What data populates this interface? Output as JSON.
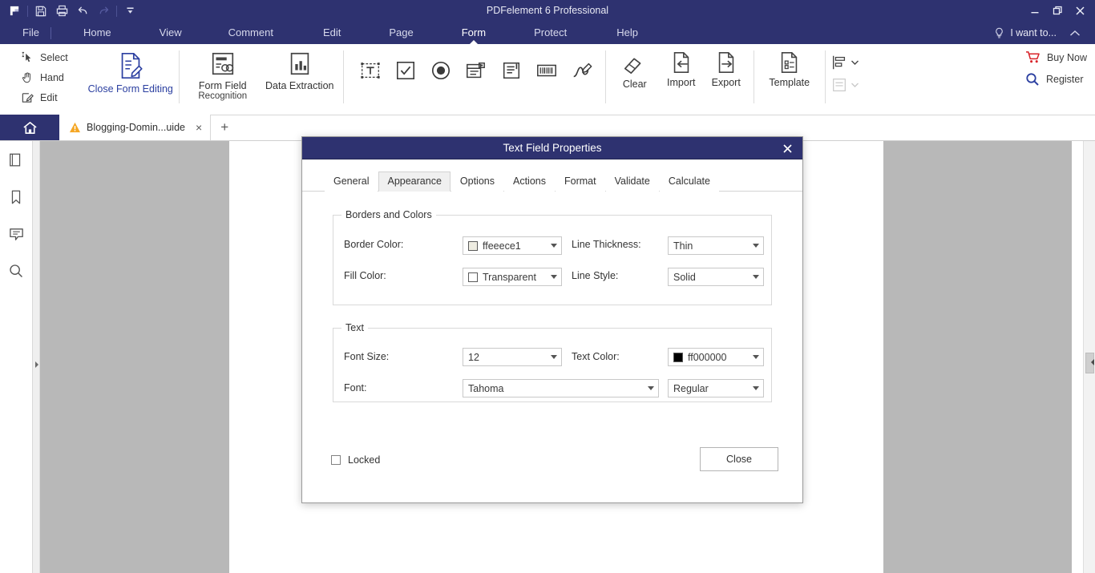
{
  "window": {
    "title": "PDFelement 6 Professional",
    "accent_color": "#2e3270",
    "quick_access": [
      {
        "name": "app-logo",
        "label": "PDFelement"
      },
      {
        "name": "save-icon",
        "label": "Save"
      },
      {
        "name": "print-icon",
        "label": "Print"
      },
      {
        "name": "undo-icon",
        "label": "Undo"
      },
      {
        "name": "redo-icon",
        "label": "Redo"
      },
      {
        "name": "customize-qat-icon",
        "label": "Customize Quick Access Toolbar"
      }
    ],
    "controls": {
      "minimize": "Minimize",
      "restore": "Restore",
      "close": "Close"
    }
  },
  "menubar": {
    "items": [
      {
        "label": "File",
        "active": false
      },
      {
        "label": "Home",
        "active": false
      },
      {
        "label": "View",
        "active": false
      },
      {
        "label": "Comment",
        "active": false
      },
      {
        "label": "Edit",
        "active": false
      },
      {
        "label": "Page",
        "active": false
      },
      {
        "label": "Form",
        "active": true
      },
      {
        "label": "Protect",
        "active": false
      },
      {
        "label": "Help",
        "active": false
      }
    ],
    "i_want_to": "I want to...",
    "collapse_icon": "chevron-up-icon"
  },
  "ribbon": {
    "tools_small": [
      {
        "label": "Select",
        "icon": "cursor-select-icon"
      },
      {
        "label": "Hand",
        "icon": "hand-icon"
      },
      {
        "label": "Edit",
        "icon": "edit-pencil-icon"
      }
    ],
    "close_form_editing": "Close Form Editing",
    "form_field_recognition": "Form Field\nRecognition",
    "form_field_recognition_line1": "Form Field",
    "form_field_recognition_line2": "Recognition",
    "data_extraction": "Data Extraction",
    "field_tools": [
      {
        "name": "text-field-tool",
        "label": "Text Field"
      },
      {
        "name": "check-box-tool",
        "label": "Check Box"
      },
      {
        "name": "radio-button-tool",
        "label": "Radio Button"
      },
      {
        "name": "combo-box-tool",
        "label": "Combo Box"
      },
      {
        "name": "list-box-tool",
        "label": "List Box"
      },
      {
        "name": "barcode-tool",
        "label": "Barcode"
      },
      {
        "name": "digital-signature-tool",
        "label": "Digital Signature"
      }
    ],
    "clear": "Clear",
    "import": "Import",
    "export": "Export",
    "template": "Template",
    "buy_now": "Buy Now",
    "register": "Register",
    "buy_now_color": "#d8232a"
  },
  "tabstrip": {
    "home_tab": "Home",
    "document_tab": "Blogging-Domin...uide",
    "document_tab_warning": "warning-triangle-icon",
    "close_label": "×",
    "add_label": "+"
  },
  "sidebar": {
    "items": [
      {
        "name": "thumbnails-icon",
        "label": "Page Thumbnails"
      },
      {
        "name": "bookmark-icon",
        "label": "Bookmarks"
      },
      {
        "name": "comment-icon",
        "label": "Comments"
      },
      {
        "name": "search-icon",
        "label": "Search"
      }
    ]
  },
  "dialog": {
    "title": "Text Field Properties",
    "close_icon": "close-icon",
    "tabs": [
      {
        "label": "General",
        "selected": false
      },
      {
        "label": "Appearance",
        "selected": true
      },
      {
        "label": "Options",
        "selected": false
      },
      {
        "label": "Actions",
        "selected": false
      },
      {
        "label": "Format",
        "selected": false
      },
      {
        "label": "Validate",
        "selected": false
      },
      {
        "label": "Calculate",
        "selected": false
      }
    ],
    "borders_and_colors": {
      "legend": "Borders and Colors",
      "border_color_label": "Border Color:",
      "border_color_value": "ffeeece1",
      "border_color_swatch": "#eeece1",
      "line_thickness_label": "Line Thickness:",
      "line_thickness_value": "Thin",
      "fill_color_label": "Fill Color:",
      "fill_color_value": "Transparent",
      "fill_color_swatch": "#ffffff",
      "line_style_label": "Line Style:",
      "line_style_value": "Solid"
    },
    "text": {
      "legend": "Text",
      "font_size_label": "Font Size:",
      "font_size_value": "12",
      "text_color_label": "Text Color:",
      "text_color_value": "ff000000",
      "text_color_swatch": "#000000",
      "font_label": "Font:",
      "font_value": "Tahoma",
      "font_style_value": "Regular"
    },
    "locked_label": "Locked",
    "locked_checked": false,
    "close_button": "Close"
  }
}
